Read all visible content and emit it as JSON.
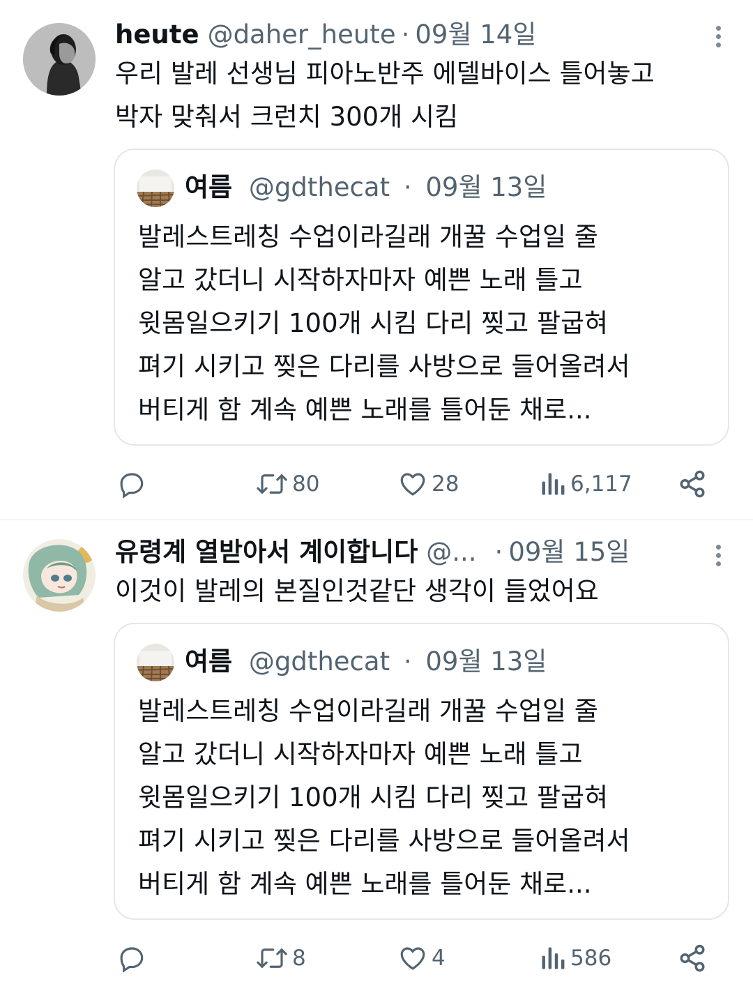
{
  "tweets": [
    {
      "display_name": "heute",
      "handle": "@daher_heute",
      "separator": "·",
      "date": "09월 14일",
      "text_lines": [
        "우리 발레 선생님 피아노반주 에델바이스 틀어놓고",
        "박자 맞춰서 크런치 300개 시킴"
      ],
      "avatar_icon": "profile-photo",
      "quote": {
        "display_name": "여름",
        "handle": "@gdthecat",
        "separator": "·",
        "date": "09월 13일",
        "text_lines": [
          "발레스트레칭 수업이라길래 개꿀 수업일 줄",
          "알고 갔더니 시작하자마자 예쁜 노래 틀고",
          "윗몸일으키기 100개 시킴 다리 찢고 팔굽혀",
          "펴기 시키고 찢은 다리를 사방으로 들어올려서",
          "버티게 함 계속 예쁜 노래를 틀어둔 채로..."
        ]
      },
      "actions": {
        "reply_count": "",
        "retweet_count": "80",
        "like_count": "28",
        "views_count": "6,117"
      }
    },
    {
      "display_name": "유령계 열받아서 계이합니다",
      "handle": "@...",
      "separator": "·",
      "date": "09월 15일",
      "text_lines": [
        "이것이 발레의 본질인것같단 생각이 들었어요"
      ],
      "avatar_icon": "anime-avatar",
      "quote": {
        "display_name": "여름",
        "handle": "@gdthecat",
        "separator": "·",
        "date": "09월 13일",
        "text_lines": [
          "발레스트레칭 수업이라길래 개꿀 수업일 줄",
          "알고 갔더니 시작하자마자 예쁜 노래 틀고",
          "윗몸일으키기 100개 시킴 다리 찢고 팔굽혀",
          "펴기 시키고 찢은 다리를 사방으로 들어올려서",
          "버티게 함 계속 예쁜 노래를 틀어둔 채로..."
        ]
      },
      "actions": {
        "reply_count": "",
        "retweet_count": "8",
        "like_count": "4",
        "views_count": "586"
      }
    }
  ],
  "colors": {
    "text": "#0f1419",
    "secondary": "#536471",
    "border": "#e4e7ea"
  },
  "icons": [
    "more-icon",
    "reply-icon",
    "retweet-icon",
    "like-icon",
    "views-icon",
    "share-icon"
  ]
}
